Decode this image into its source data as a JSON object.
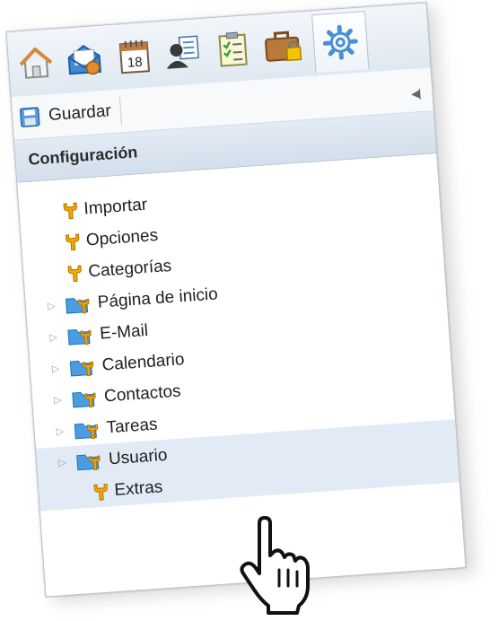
{
  "toolbar": {
    "save_label": "Guardar"
  },
  "nav_icons": [
    {
      "name": "home-icon"
    },
    {
      "name": "mail-icon"
    },
    {
      "name": "calendar-icon",
      "day": "18"
    },
    {
      "name": "contacts-icon"
    },
    {
      "name": "tasks-icon"
    },
    {
      "name": "briefcase-lock-icon"
    },
    {
      "name": "settings-icon",
      "selected": true
    }
  ],
  "panel": {
    "title": "Configuración"
  },
  "tree": {
    "items": [
      {
        "label": "Importar"
      },
      {
        "label": "Opciones"
      },
      {
        "label": "Categorías"
      },
      {
        "label": "Página de inicio"
      },
      {
        "label": "E-Mail"
      },
      {
        "label": "Calendario"
      },
      {
        "label": "Contactos"
      },
      {
        "label": "Tareas"
      },
      {
        "label": "Usuario"
      },
      {
        "label": "Extras"
      }
    ]
  },
  "colors": {
    "accent": "#4a8fd6",
    "wrench": "#f5a800",
    "folder": "#4a9de0",
    "hover_row": "#e2ebf5"
  }
}
